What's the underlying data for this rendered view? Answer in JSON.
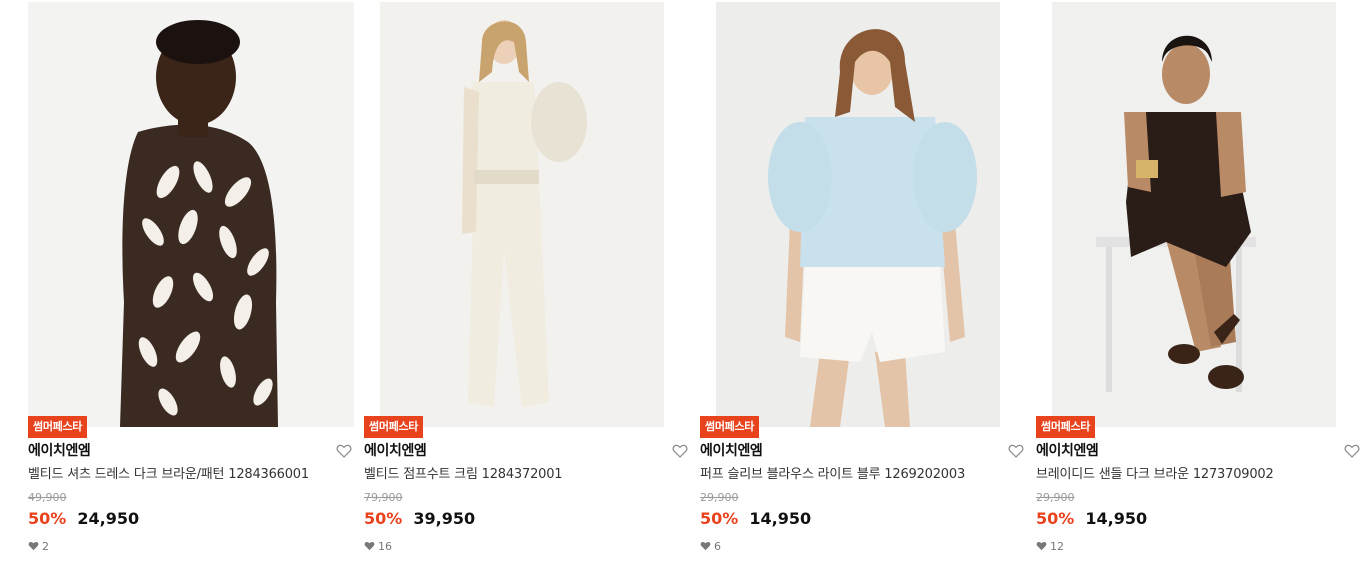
{
  "products": [
    {
      "badge": "썸머페스타",
      "brand": "에이치엔엠",
      "name": "벨티드 셔츠 드레스 다크 브라운/패턴 1284366001",
      "original_price": "49,900",
      "discount": "50%",
      "price": "24,950",
      "likes": "2",
      "photo_desc": "model in brown leaf-pattern shirt dress"
    },
    {
      "badge": "썸머페스타",
      "brand": "에이치엔엠",
      "name": "벨티드 점프수트 크림 1284372001",
      "original_price": "79,900",
      "discount": "50%",
      "price": "39,950",
      "likes": "16",
      "photo_desc": "model in cream belted jumpsuit"
    },
    {
      "badge": "썸머페스타",
      "brand": "에이치엔엠",
      "name": "퍼프 슬리브 블라우스 라이트 블루 1269202003",
      "original_price": "29,900",
      "discount": "50%",
      "price": "14,950",
      "likes": "6",
      "photo_desc": "model in light blue puff sleeve blouse"
    },
    {
      "badge": "썸머페스타",
      "brand": "에이치엔엠",
      "name": "브레이디드 샌들 다크 브라운 1273709002",
      "original_price": "29,900",
      "discount": "50%",
      "price": "14,950",
      "likes": "12",
      "photo_desc": "seated model wearing dark brown braided sandals"
    }
  ],
  "colors": {
    "accent": "#e8431c",
    "strike": "#9a9a9a"
  },
  "icons": {
    "wishlist": "heart-outline-icon",
    "like_count": "heart-filled-icon"
  }
}
